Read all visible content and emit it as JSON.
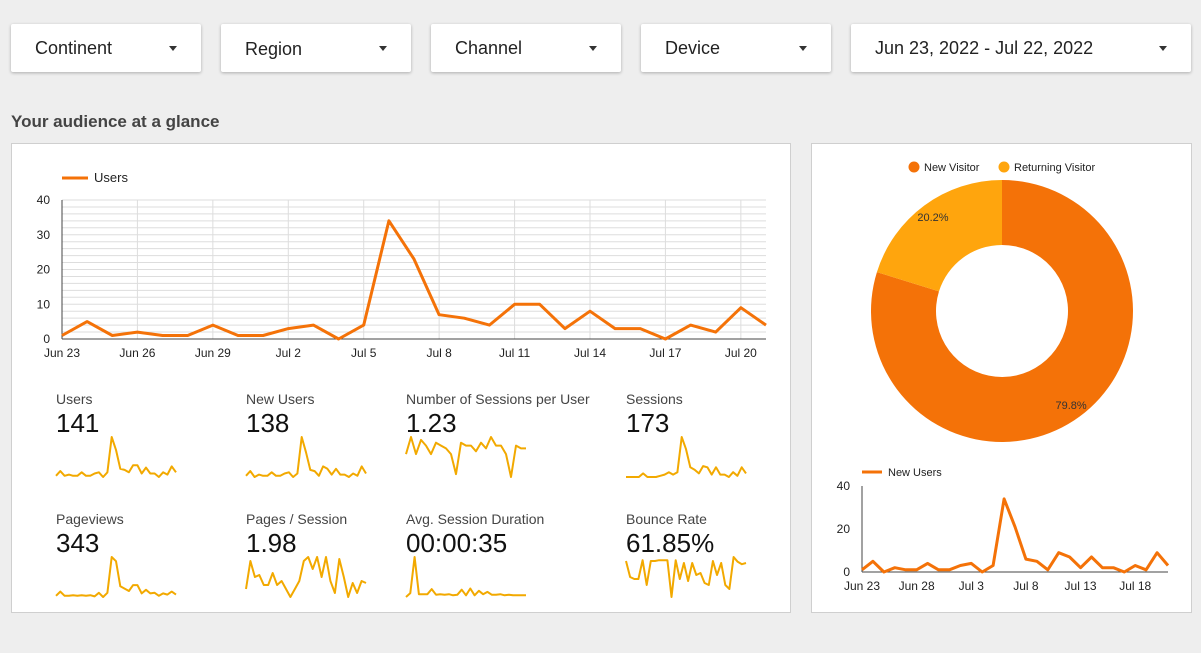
{
  "filters": [
    {
      "label": "Continent"
    },
    {
      "label": "Region"
    },
    {
      "label": "Channel"
    },
    {
      "label": "Device"
    },
    {
      "label": "Jun 23, 2022 - Jul 22, 2022"
    }
  ],
  "section_title": "Your audience at a glance",
  "colors": {
    "primary": "#f47208",
    "secondary": "#ffa50d",
    "spark": "#f2a900"
  },
  "chart_data": [
    {
      "type": "line",
      "legend": [
        "Users"
      ],
      "x": [
        "Jun 23",
        "Jun 24",
        "Jun 25",
        "Jun 26",
        "Jun 27",
        "Jun 28",
        "Jun 29",
        "Jun 30",
        "Jul 1",
        "Jul 2",
        "Jul 3",
        "Jul 4",
        "Jul 5",
        "Jul 6",
        "Jul 7",
        "Jul 8",
        "Jul 9",
        "Jul 10",
        "Jul 11",
        "Jul 12",
        "Jul 13",
        "Jul 14",
        "Jul 15",
        "Jul 16",
        "Jul 17",
        "Jul 18",
        "Jul 19",
        "Jul 20",
        "Jul 21"
      ],
      "x_ticks": [
        "Jun 23",
        "Jun 26",
        "Jun 29",
        "Jul 2",
        "Jul 5",
        "Jul 8",
        "Jul 11",
        "Jul 14",
        "Jul 17",
        "Jul 20"
      ],
      "series": [
        {
          "name": "Users",
          "values": [
            1,
            5,
            1,
            2,
            1,
            1,
            4,
            1,
            1,
            3,
            4,
            0,
            4,
            34,
            23,
            7,
            6,
            4,
            10,
            10,
            3,
            8,
            3,
            3,
            0,
            4,
            2,
            9,
            4
          ]
        }
      ],
      "ylim": [
        0,
        40
      ],
      "y_ticks": [
        0,
        10,
        20,
        30,
        40
      ],
      "grid": true,
      "legend_position": "top-left"
    },
    {
      "type": "pie",
      "style": "donut",
      "legend_position": "top",
      "slices": [
        {
          "label": "New Visitor",
          "value": 79.8,
          "display": "79.8%"
        },
        {
          "label": "Returning Visitor",
          "value": 20.2,
          "display": "20.2%"
        }
      ]
    },
    {
      "type": "line",
      "legend": [
        "New Users"
      ],
      "x": [
        "Jun 23",
        "Jun 24",
        "Jun 25",
        "Jun 26",
        "Jun 27",
        "Jun 28",
        "Jun 29",
        "Jun 30",
        "Jul 1",
        "Jul 2",
        "Jul 3",
        "Jul 4",
        "Jul 5",
        "Jul 6",
        "Jul 7",
        "Jul 8",
        "Jul 9",
        "Jul 10",
        "Jul 11",
        "Jul 12",
        "Jul 13",
        "Jul 14",
        "Jul 15",
        "Jul 16",
        "Jul 17",
        "Jul 18",
        "Jul 19",
        "Jul 20",
        "Jul 21"
      ],
      "x_ticks": [
        "Jun 23",
        "Jun 28",
        "Jul 3",
        "Jul 8",
        "Jul 13",
        "Jul 18"
      ],
      "series": [
        {
          "name": "New Users",
          "values": [
            1,
            5,
            0,
            2,
            1,
            1,
            4,
            1,
            1,
            3,
            4,
            0,
            3,
            34,
            21,
            6,
            5,
            1,
            9,
            7,
            2,
            7,
            2,
            2,
            0,
            3,
            1,
            9,
            3
          ]
        }
      ],
      "ylim": [
        0,
        40
      ],
      "y_ticks": [
        0,
        20,
        40
      ],
      "grid": false,
      "legend_position": "top-left"
    },
    {
      "type": "table",
      "scorecards": [
        {
          "label": "Users",
          "value": "141",
          "spark": [
            1,
            5,
            1,
            2,
            1,
            1,
            4,
            1,
            1,
            3,
            4,
            0,
            4,
            34,
            23,
            7,
            6,
            4,
            10,
            10,
            3,
            8,
            3,
            3,
            0,
            4,
            2,
            9,
            4
          ]
        },
        {
          "label": "New Users",
          "value": "138",
          "spark": [
            1,
            5,
            0,
            2,
            1,
            1,
            4,
            1,
            1,
            3,
            4,
            0,
            3,
            34,
            21,
            6,
            5,
            1,
            9,
            7,
            2,
            7,
            2,
            2,
            0,
            3,
            1,
            9,
            3
          ]
        },
        {
          "label": "Number of Sessions per User",
          "value": "1.23",
          "spark": [
            1.0,
            1.6,
            1.0,
            1.5,
            1.3,
            1.0,
            1.4,
            1.3,
            1.2,
            1.0,
            0.3,
            1.4,
            1.3,
            1.3,
            1.1,
            1.4,
            1.2,
            1.6,
            1.3,
            1.3,
            1.0,
            0.2,
            1.3,
            1.2,
            1.2
          ]
        },
        {
          "label": "Sessions",
          "value": "173",
          "spark": [
            1,
            1,
            1,
            1,
            4,
            1,
            1,
            1,
            2,
            3,
            5,
            3,
            5,
            34,
            24,
            9,
            7,
            4,
            10,
            9,
            3,
            9,
            3,
            3,
            1,
            5,
            2,
            9,
            4
          ]
        },
        {
          "label": "Pageviews",
          "value": "343",
          "spark": [
            2,
            9,
            2,
            2,
            3,
            2,
            3,
            2,
            3,
            1,
            7,
            0,
            7,
            67,
            60,
            18,
            14,
            10,
            20,
            20,
            6,
            12,
            6,
            7,
            2,
            6,
            4,
            9,
            4
          ]
        },
        {
          "label": "Pages / Session",
          "value": "1.98",
          "spark": [
            2.0,
            3.4,
            2.6,
            2.7,
            2.2,
            2.2,
            2.8,
            2.2,
            2.4,
            2.0,
            1.6,
            2.0,
            2.4,
            3.4,
            3.6,
            3.0,
            3.6,
            2.6,
            3.6,
            2.4,
            1.8,
            3.5,
            2.6,
            1.6,
            2.3,
            1.8,
            2.4,
            2.3
          ]
        },
        {
          "label": "Avg. Session Duration",
          "value": "00:00:35",
          "spark": [
            1,
            8,
            72,
            6,
            6,
            6,
            15,
            5,
            6,
            5,
            6,
            4,
            5,
            14,
            4,
            16,
            4,
            12,
            6,
            10,
            5,
            5,
            6,
            4,
            5,
            4,
            4,
            4,
            4
          ]
        },
        {
          "label": "Bounce Rate",
          "value": "61.85%",
          "spark": [
            90,
            50,
            45,
            45,
            92,
            30,
            90,
            90,
            92,
            92,
            92,
            0,
            92,
            45,
            85,
            40,
            85,
            55,
            60,
            35,
            30,
            90,
            55,
            85,
            30,
            20,
            100,
            88,
            82,
            85
          ]
        }
      ]
    }
  ]
}
